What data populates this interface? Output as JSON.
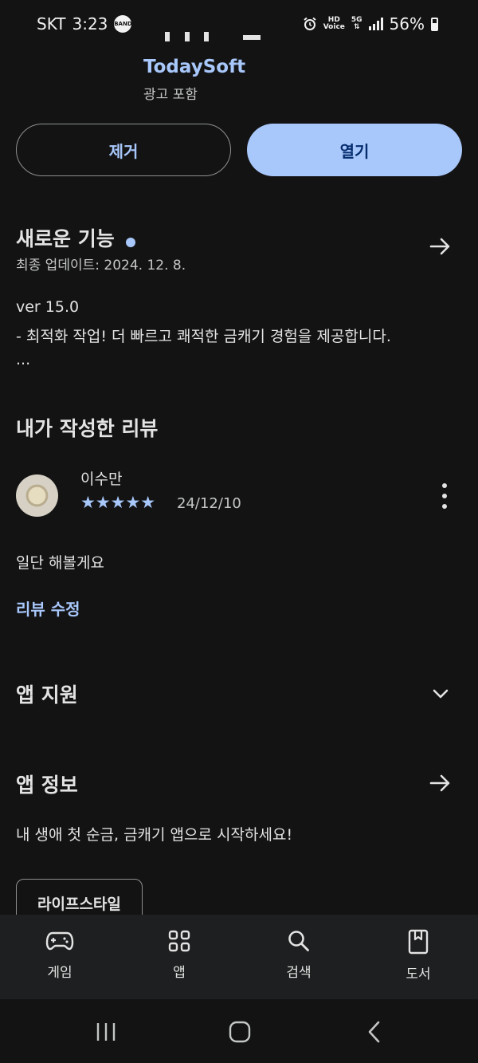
{
  "status_bar": {
    "carrier": "SKT",
    "time": "3:23",
    "notification_icon": "BAND",
    "hd_label": "HD",
    "voice_label": "Voice",
    "network": "5G",
    "battery": "56%",
    "battery_level": 0.56
  },
  "app": {
    "developer": "TodaySoft",
    "ads_notice": "광고 포함"
  },
  "actions": {
    "uninstall": "제거",
    "open": "열기"
  },
  "whats_new": {
    "title": "새로운 기능",
    "updated": "최종 업데이트: 2024. 12. 8.",
    "version": "ver 15.0",
    "note": "- 최적화 작업! 더 빠르고 쾌적한 금캐기 경험을 제공합니다.",
    "more": "..."
  },
  "my_review": {
    "title": "내가 작성한 리뷰",
    "author": "이수만",
    "stars": "★★★★★",
    "rating": 5,
    "date": "24/12/10",
    "text": "일단 해볼게요",
    "edit": "리뷰 수정"
  },
  "app_support": {
    "title": "앱 지원"
  },
  "about": {
    "title": "앱 정보",
    "description": "내 생애 첫 순금, 금캐기 앱으로 시작하세요!",
    "category": "라이프스타일"
  },
  "bottom_nav": {
    "items": [
      {
        "label": "게임",
        "icon": "gamepad-icon"
      },
      {
        "label": "앱",
        "icon": "apps-grid-icon"
      },
      {
        "label": "검색",
        "icon": "search-icon"
      },
      {
        "label": "도서",
        "icon": "book-icon"
      }
    ]
  },
  "theme": {
    "background": "#131314",
    "accent": "#a8c7fa",
    "nav_background": "#1e1f20"
  }
}
